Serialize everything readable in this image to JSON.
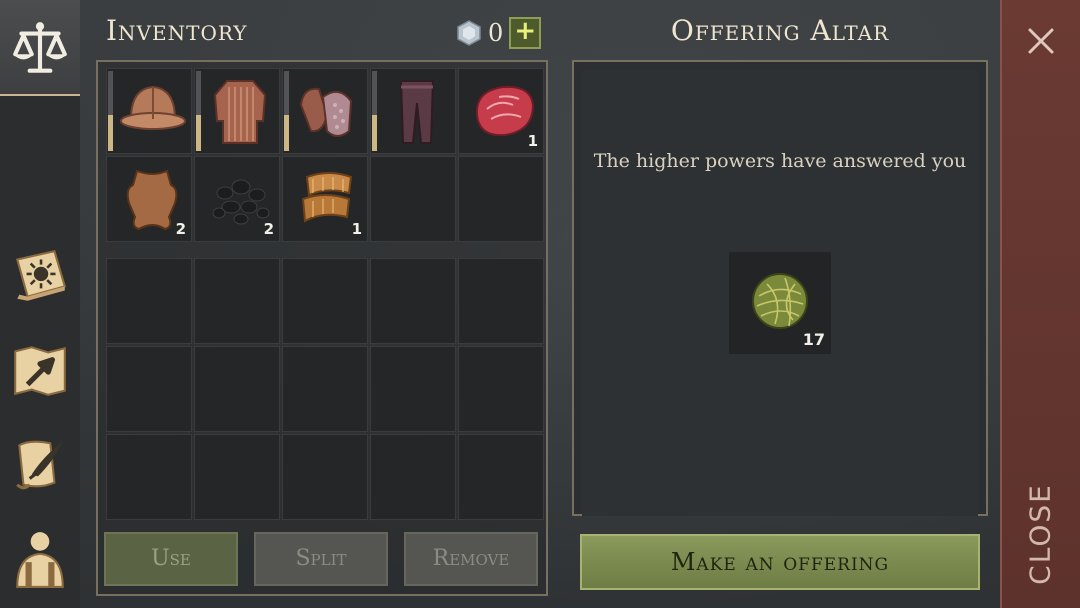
{
  "inventory": {
    "title": "Inventory",
    "currency": {
      "value": "0",
      "icon": "silver-coin-icon",
      "add_label": "+"
    },
    "items": [
      {
        "icon": "leather-helmet-icon",
        "durability": 0.45
      },
      {
        "icon": "chainmail-shirt-icon",
        "durability": 0.45
      },
      {
        "icon": "chainmail-gloves-icon",
        "durability": 0.45
      },
      {
        "icon": "leather-pants-icon",
        "durability": 0.45
      },
      {
        "icon": "raw-meat-icon",
        "qty": "1"
      },
      {
        "icon": "animal-hide-icon",
        "qty": "2"
      },
      {
        "icon": "coal-icon",
        "qty": "2"
      },
      {
        "icon": "cloth-scrap-icon",
        "qty": "1"
      }
    ],
    "buttons": {
      "use": "Use",
      "split": "Split",
      "remove": "Remove"
    }
  },
  "altar": {
    "title": "Offering Altar",
    "message": "The higher powers have answered you",
    "reward": {
      "icon": "plant-fiber-bundle-icon",
      "qty": "17"
    },
    "offer_button": "Make an offering"
  },
  "sidebar": {
    "items": [
      {
        "name": "scales-icon",
        "active": true
      },
      {
        "name": "sun-book-icon"
      },
      {
        "name": "map-arrow-icon"
      },
      {
        "name": "scroll-quill-icon"
      },
      {
        "name": "character-icon"
      }
    ]
  },
  "close": {
    "label": "CLOSE",
    "icon": "close-x-icon"
  },
  "colors": {
    "accent_green": "#8a9a5c",
    "close_red": "#6a3a33",
    "panel_border": "#77705e",
    "durability": "#cdb784"
  }
}
